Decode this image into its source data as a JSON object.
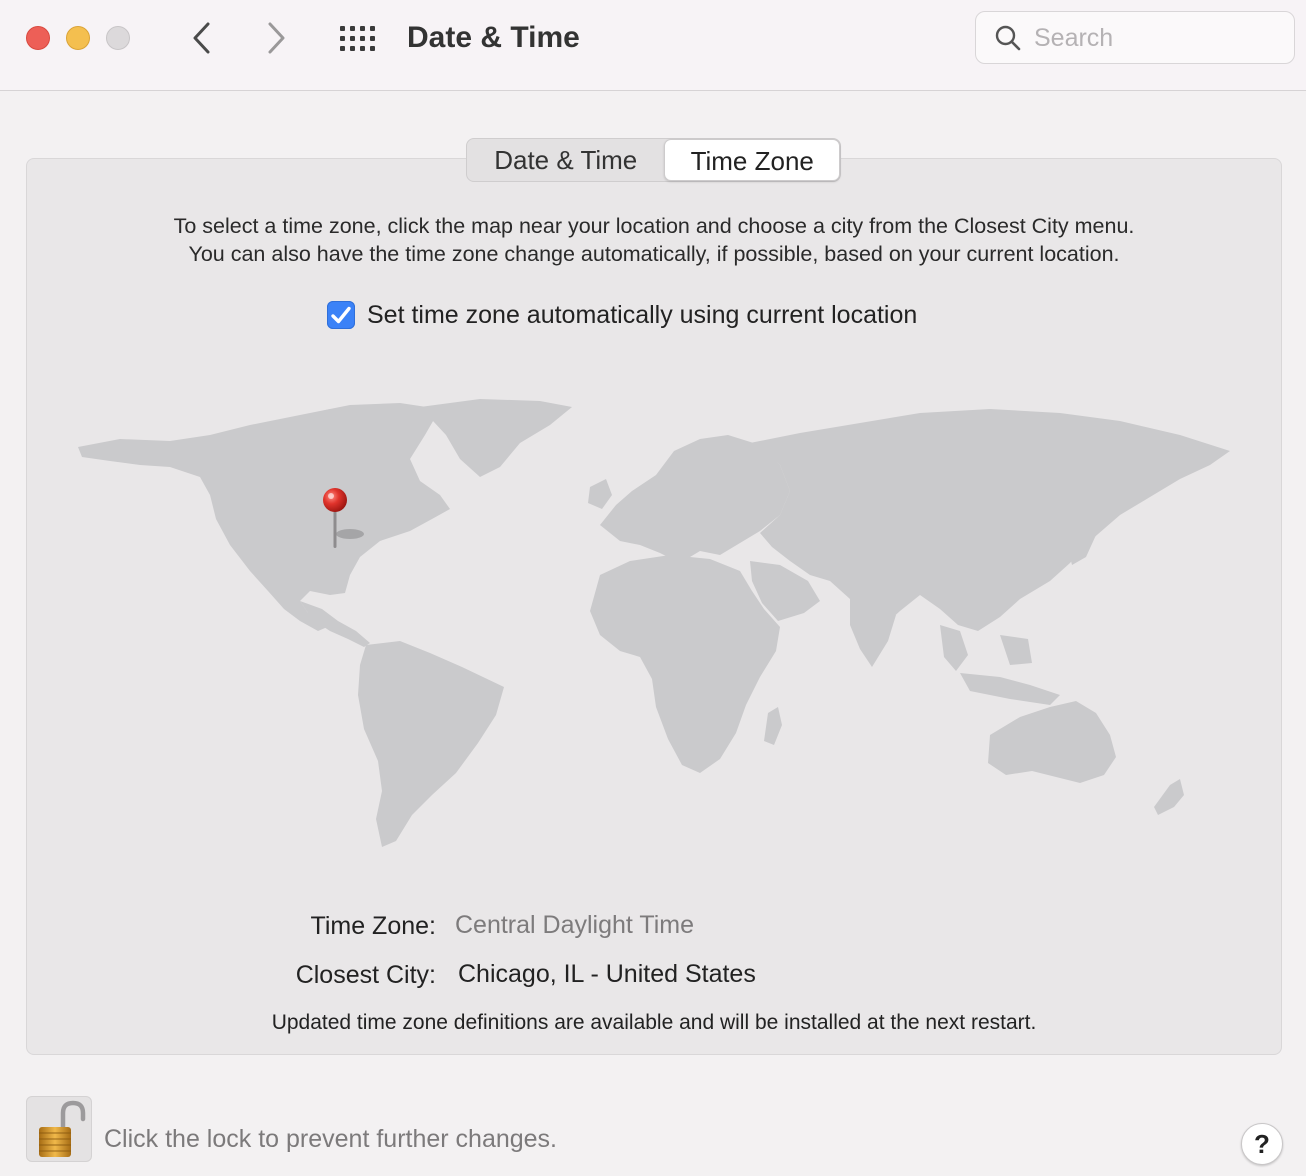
{
  "window": {
    "title": "Date & Time",
    "controls": [
      "close",
      "minimize",
      "zoom"
    ]
  },
  "toolbar": {
    "back_icon": "chevron-left-icon",
    "forward_icon": "chevron-right-icon",
    "grid_icon": "grid-icon",
    "search_placeholder": "Search",
    "search_value": ""
  },
  "tabs": [
    {
      "label": "Date & Time",
      "selected": false
    },
    {
      "label": "Time Zone",
      "selected": true
    }
  ],
  "time_zone": {
    "instructions": [
      "To select a time zone, click the map near your location and choose a city from the Closest City menu.",
      "You can also have the time zone change automatically, if possible, based on your current location."
    ],
    "auto_checkbox_label": "Set time zone automatically using current location",
    "auto_checked": true,
    "map": {
      "pin_icon": "map-pin-icon"
    },
    "time_zone_label": "Time Zone:",
    "time_zone_value": "Central Daylight Time",
    "closest_city_label": "Closest City:",
    "closest_city_value": "Chicago, IL - United States",
    "update_note": "Updated time zone definitions are available and will be installed at the next restart."
  },
  "footer": {
    "lock_icon": "lock-open-icon",
    "lock_text": "Click the lock to prevent further changes.",
    "help_label": "?"
  },
  "colors": {
    "accent": "#3b82f7",
    "close": "#ed5f57",
    "minimize": "#f4bf4f",
    "pin": "#e0332b"
  }
}
